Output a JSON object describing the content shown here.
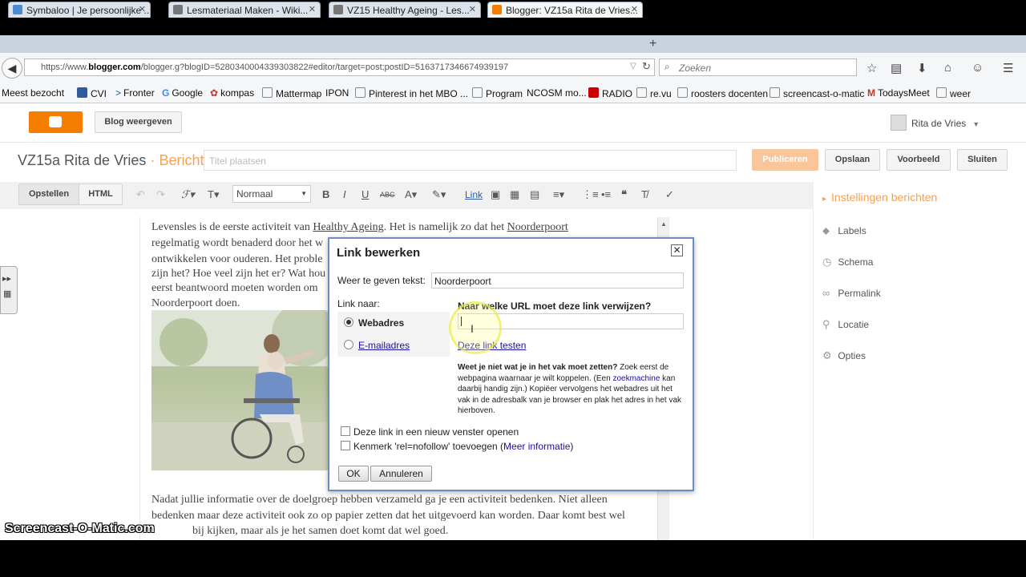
{
  "browser": {
    "tabs": [
      {
        "title": "Symbaloo | Je persoonlijke ...",
        "fav": "#4c8bd1"
      },
      {
        "title": "Lesmateriaal Maken - Wiki...",
        "fav": "#777777"
      },
      {
        "title": "VZ15 Healthy Ageing - Les...",
        "fav": "#777777"
      },
      {
        "title": "Blogger: VZ15a Rita de Vries...",
        "fav": "#f57d00"
      }
    ],
    "url_prefix": "https://www.",
    "url_domain": "blogger.com",
    "url_rest": "/blogger.g?blogID=5280340004339303822#editor/target=post;postID=5163717346674939197",
    "search_placeholder": "Zoeken",
    "bookmarks": [
      "Meest bezocht",
      "CVI",
      "Fronter",
      "Google",
      "kompas",
      "Mattermap",
      "IPON",
      "Pinterest in het MBO ...",
      "Program",
      "NCOSM mo...",
      "RADIO",
      "re.vu",
      "roosters docenten",
      "screencast-o-matic",
      "TodaysMeet",
      "weer"
    ]
  },
  "blogger": {
    "view_blog": "Blog weergeven",
    "user": "Rita de Vries",
    "blog_title": "VZ15a Rita de Vries",
    "sep": "·",
    "section": "Bericht",
    "title_placeholder": "Titel plaatsen",
    "actions": {
      "publish": "Publiceren",
      "save": "Opslaan",
      "preview": "Voorbeeld",
      "close": "Sluiten"
    },
    "modes": {
      "compose": "Opstellen",
      "html": "HTML"
    },
    "format": "Normaal",
    "toolbar_link": "Link",
    "paragraph1": [
      "Levensles is de eerste activiteit van",
      "Healthy Ageing",
      ". Het is namelijk zo dat het",
      "Noorderpoort"
    ],
    "lines": [
      "regelmatig wordt benaderd door het w",
      "ontwikkelen voor ouderen. Het proble",
      "zijn het? Hoe veel zijn het er? Wat hou",
      "eerst beantwoord moeten worden om",
      "Noorderpoort doen."
    ],
    "paragraph2": [
      "Nadat jullie informatie over de doelgroep hebben verzameld ga je een activiteit bedenken. Niet alleen",
      "bedenken maar deze activiteit ook zo op papier zetten dat het uitgevoerd kan worden. Daar komt best wel",
      "bij kijken, maar als je het samen doet komt dat wel goed."
    ]
  },
  "sidebar": {
    "heading": "Instellingen berichten",
    "items": [
      "Labels",
      "Schema",
      "Permalink",
      "Locatie",
      "Opties"
    ]
  },
  "dialog": {
    "title": "Link bewerken",
    "text_label": "Weer te geven tekst:",
    "text_value": "Noorderpoort",
    "link_to": "Link naar:",
    "web": "Webadres",
    "email": "E-mailadres",
    "url_question": "Naar welke URL moet deze link verwijzen?",
    "test_link": "Deze link testen",
    "help_bold": "Weet je niet wat je in het vak moet zetten?",
    "help_1": " Zoek eerst de webpagina waarnaar je wilt koppelen. (Een ",
    "help_link": "zoekmachine",
    "help_2": " kan daarbij handig zijn.) Kopiëer vervolgens het webadres uit het vak in de adresbalk van je browser en plak het adres in het vak hierboven.",
    "new_window": "Deze link in een nieuw venster openen",
    "nofollow": "Kenmerk 'rel=nofollow' toevoegen (",
    "more_info": "Meer informatie",
    "nofollow_end": ")",
    "ok": "OK",
    "cancel": "Annuleren"
  },
  "watermark": "Screencast-O-Matic.com"
}
